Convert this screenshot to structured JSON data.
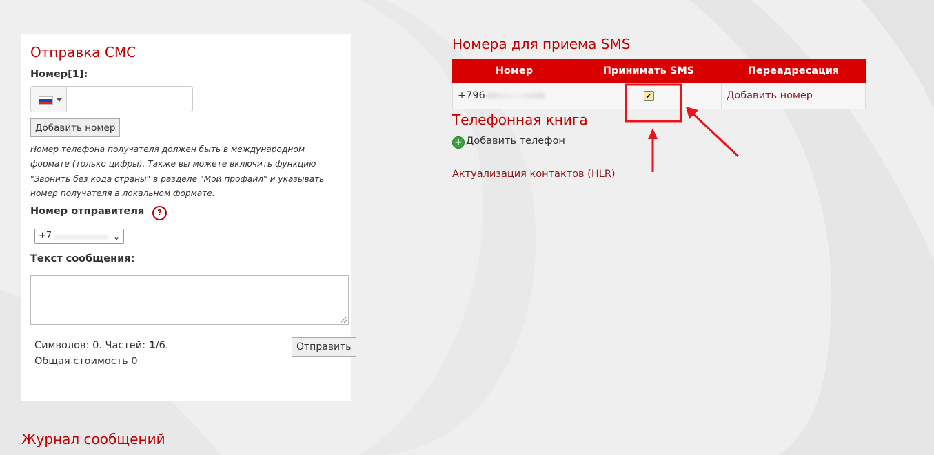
{
  "send_sms": {
    "title": "Отправка СМС",
    "number_label": "Номер[1]:",
    "phone_value": "",
    "add_number_button": "Добавить номер",
    "hint": "Номер телефона получателя должен быть в международном формате (только цифры). Также вы можете включить функцию \"Звонить без кода страны\" в разделе \"Мой профайл\" и указывать номер получателя в локальном формате.",
    "sender_label": "Номер отправителя",
    "help_icon_glyph": "?",
    "sender_value": "+7",
    "message_label": "Текст сообщения:",
    "message_value": "",
    "chars_label": "Символов: 0. Частей: ",
    "parts_current": "1",
    "parts_total": "/6.",
    "total_cost": "Общая стоимость 0",
    "send_button": "Отправить"
  },
  "sms_numbers": {
    "title": "Номера для приема SMS",
    "columns": [
      "Номер",
      "Принимать SMS",
      "Переадресация"
    ],
    "rows": [
      {
        "number": "+796",
        "accept_sms": true,
        "forward_link": "Добавить номер"
      }
    ],
    "checkmark_glyph": "✔"
  },
  "phonebook": {
    "title": "Телефонная книга",
    "add_phone": "Добавить телефон",
    "hlr_link": "Актуализация контактов (HLR)"
  },
  "journal": {
    "title": "Журнал сообщений"
  },
  "colors": {
    "accent_red": "#c00000",
    "table_header": "#d80000",
    "annotation_red": "#e8141c"
  },
  "icons": [
    "flag-ru-icon",
    "caret-down-icon",
    "help-icon",
    "chevron-down-icon",
    "resize-grip-icon",
    "checkmark-icon",
    "plus-circle-icon"
  ]
}
